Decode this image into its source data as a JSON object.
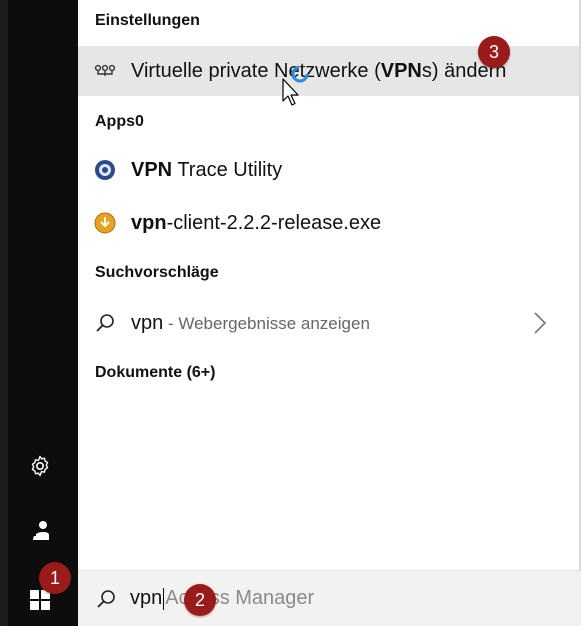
{
  "sidebar": {
    "icons": [
      "gear-icon",
      "user-account-icon",
      "windows-start-icon"
    ]
  },
  "sections": {
    "settings": "Einstellungen",
    "apps": "Apps0",
    "suggestions": "Suchvorschläge",
    "documents": "Dokumente (6+)"
  },
  "results": {
    "vpn_settings": {
      "icon": "vpn-network-icon",
      "label_pre": "Virtuelle private Netzwerke (",
      "label_bold": "VPN",
      "label_post": "s) ändern"
    },
    "trace_utility": {
      "icon": "trace-utility-app-icon",
      "label_bold": "VPN",
      "label_post": " Trace Utility"
    },
    "vpn_client": {
      "icon": "installer-exe-icon",
      "label_bold": "vpn",
      "label_post": "-client-2.2.2-release.exe"
    },
    "web_suggestion": {
      "icon": "search-icon",
      "label": "vpn",
      "sub": " - Webergebnisse anzeigen"
    }
  },
  "search": {
    "value": "vpn",
    "placeholder_rest": "Access Manager"
  },
  "badges": {
    "one": "1",
    "two": "2",
    "three": "3"
  },
  "colors": {
    "badge": "#9b1b1b",
    "highlight": "#e6e6e6",
    "sidebar": "#0d0d0d",
    "cursor_ring": "#2a8be0"
  }
}
